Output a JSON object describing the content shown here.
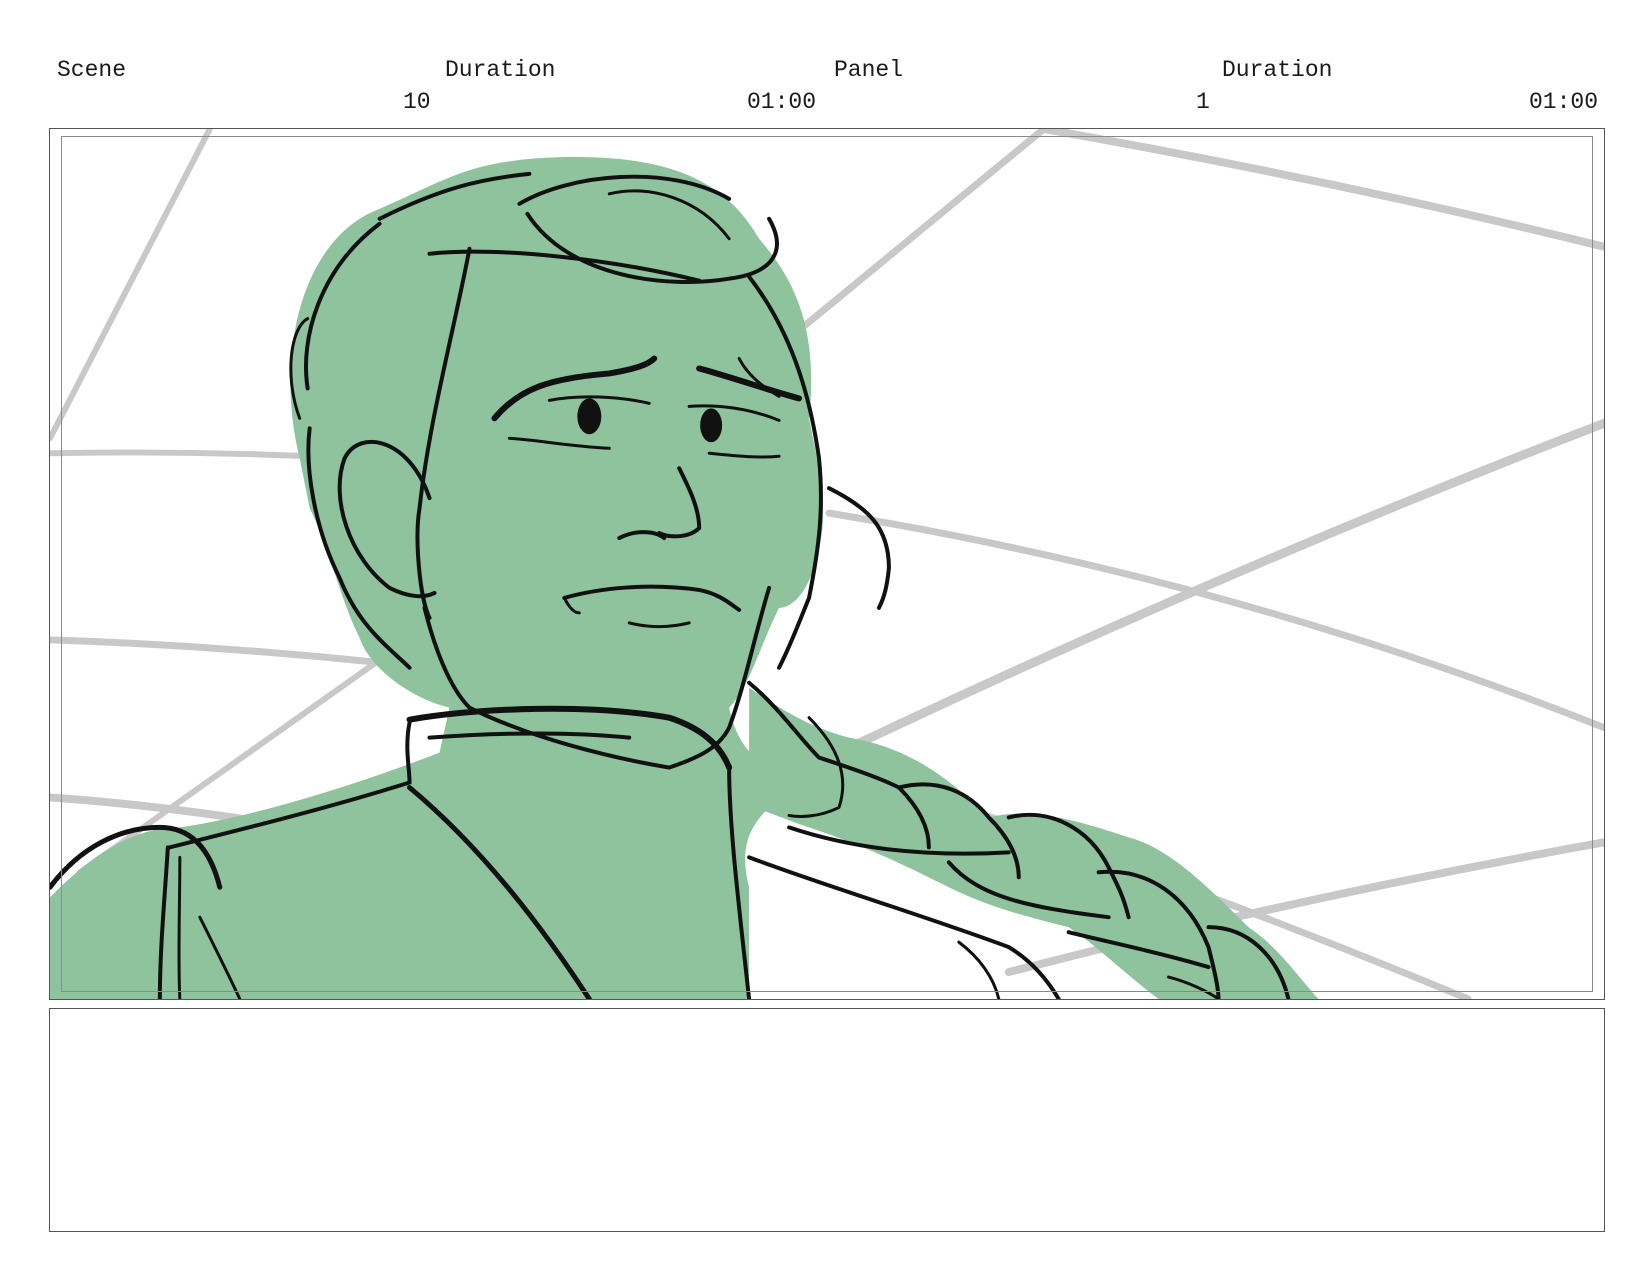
{
  "header": {
    "scene_label": "Scene",
    "scene_duration_label": "Duration",
    "panel_label": "Panel",
    "panel_duration_label": "Duration",
    "scene_number": "10",
    "scene_duration": "01:00",
    "panel_number": "1",
    "panel_duration": "01:00"
  },
  "panel_image": {
    "fill_color": "#8fc39e",
    "line_color": "#111111",
    "background_line_color": "#c8c8c8"
  },
  "notes": {
    "text": ""
  }
}
